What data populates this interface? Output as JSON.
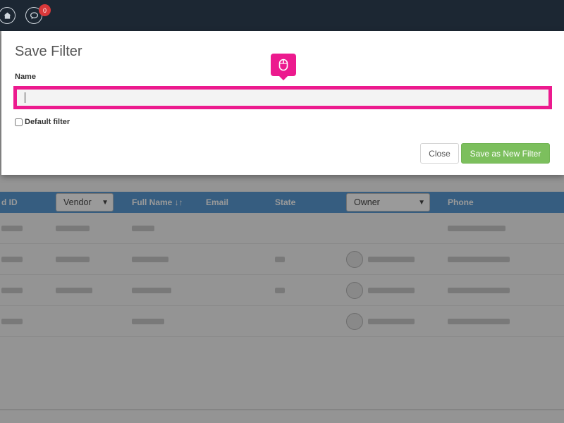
{
  "topbar": {
    "notification_count": "0",
    "icons": [
      "home-icon",
      "chat-icon"
    ]
  },
  "table": {
    "headers": {
      "id": "d ID",
      "vendor": "Vendor",
      "full_name": "Full Name ↓↑",
      "email": "Email",
      "state": "State",
      "owner": "Owner",
      "phone": "Phone"
    }
  },
  "modal": {
    "title": "Save Filter",
    "name_label": "Name",
    "name_value": "",
    "default_filter_label": "Default filter",
    "default_filter_checked": false,
    "close_label": "Close",
    "save_label": "Save as New Filter"
  },
  "colors": {
    "accent": "#ec1a8e",
    "save_button": "#7cbf5d",
    "table_header": "#4a91cf",
    "topbar": "#1c2733",
    "badge": "#d9383a"
  }
}
